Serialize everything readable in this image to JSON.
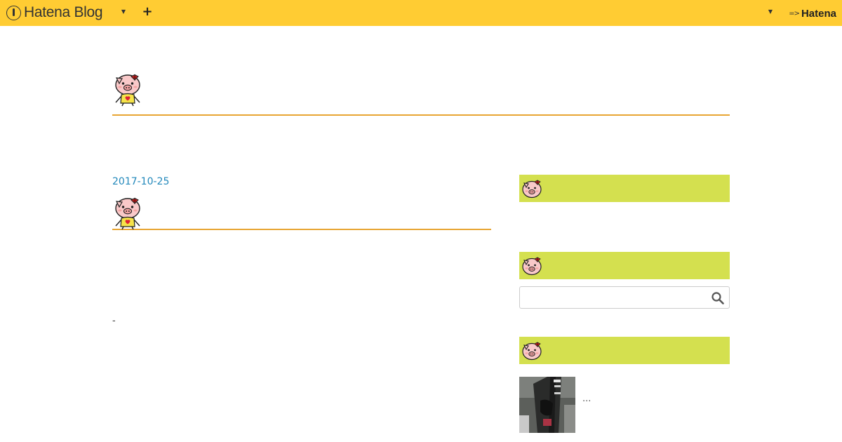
{
  "header": {
    "logo_text": "Hatena Blog",
    "hatena_text": "Hatena",
    "plus_label": "+",
    "background_color": "#ffcc33"
  },
  "blog": {
    "title_icon": "pig-icon",
    "title_text": ""
  },
  "entry": {
    "date": "2017-10-25",
    "title_icon": "pig-icon",
    "body_text": "-"
  },
  "sidebar": {
    "modules": [
      {
        "icon": "pig-icon",
        "title": ""
      },
      {
        "icon": "pig-icon",
        "title": ""
      },
      {
        "icon": "pig-icon",
        "title": ""
      }
    ],
    "search": {
      "placeholder": "",
      "icon": "search-icon"
    },
    "recent_entry": {
      "excerpt": "..."
    },
    "module_color": "#d4e04f"
  },
  "colors": {
    "accent_line": "#e8a532",
    "link": "#2288bb"
  }
}
